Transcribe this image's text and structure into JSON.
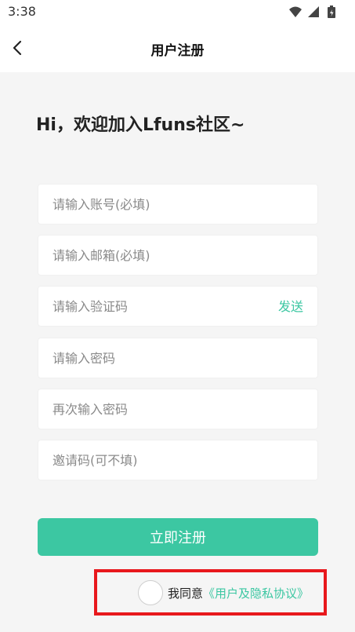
{
  "status_bar": {
    "time": "3:38",
    "icons": [
      "wifi-icon",
      "signal-icon",
      "battery-icon"
    ]
  },
  "header": {
    "title": "用户注册",
    "back_icon": "chevron-left-icon"
  },
  "welcome": "Hi，欢迎加入Lfuns社区~",
  "form": {
    "account_placeholder": "请输入账号(必填)",
    "email_placeholder": "请输入邮箱(必填)",
    "code_placeholder": "请输入验证码",
    "send_label": "发送",
    "password_placeholder": "请输入密码",
    "confirm_password_placeholder": "再次输入密码",
    "invite_code_placeholder": "邀请码(可不填)"
  },
  "register_button": "立即注册",
  "agreement": {
    "prefix": "我同意",
    "link": "《用户及隐私协议》"
  },
  "colors": {
    "accent": "#3cc7a2",
    "highlight_border": "#e8181c"
  }
}
